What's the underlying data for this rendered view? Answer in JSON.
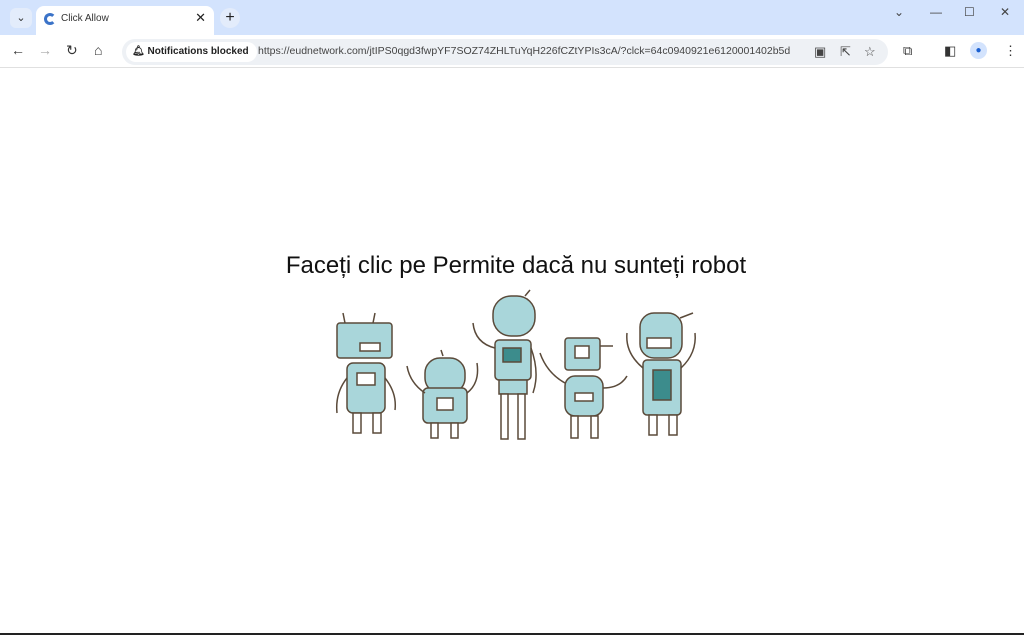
{
  "browser": {
    "tab": {
      "title": "Click Allow",
      "favicon": "loading-icon"
    },
    "notification_chip": "Notifications blocked",
    "url": "https://eudnetwork.com/jtIPS0qgd3fwpYF7SOZ74ZHLTuYqH226fCZtYPIs3cA/?clck=64c0940921e6120001402b5d"
  },
  "page": {
    "heading": "Faceți clic pe Permite dacă nu sunteți robot",
    "robot_color": "#a9d6da"
  }
}
